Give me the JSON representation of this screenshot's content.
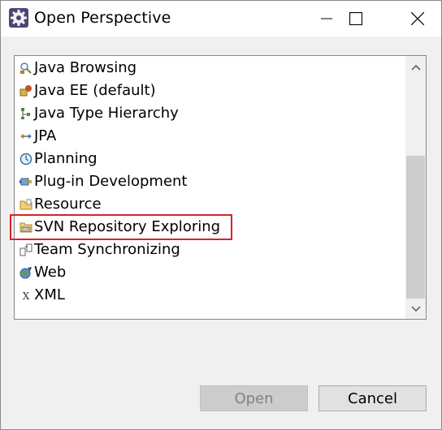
{
  "window": {
    "title": "Open Perspective",
    "controls": {
      "minimize": "minimize",
      "maximize": "maximize",
      "close": "close"
    }
  },
  "perspectives": [
    {
      "label": "Java Browsing",
      "icon": "java-browsing-icon"
    },
    {
      "label": "Java EE (default)",
      "icon": "java-ee-icon"
    },
    {
      "label": "Java Type Hierarchy",
      "icon": "type-hierarchy-icon"
    },
    {
      "label": "JPA",
      "icon": "jpa-icon"
    },
    {
      "label": "Planning",
      "icon": "planning-icon"
    },
    {
      "label": "Plug-in Development",
      "icon": "plugin-icon"
    },
    {
      "label": "Resource",
      "icon": "resource-icon"
    },
    {
      "label": "SVN Repository Exploring",
      "icon": "svn-icon",
      "highlighted": true
    },
    {
      "label": "Team Synchronizing",
      "icon": "team-sync-icon"
    },
    {
      "label": "Web",
      "icon": "web-icon"
    },
    {
      "label": "XML",
      "icon": "xml-icon"
    }
  ],
  "buttons": {
    "open": "Open",
    "cancel": "Cancel",
    "open_enabled": false
  },
  "colors": {
    "highlight_border": "#d9232b",
    "disabled_button": "#cccccc",
    "button": "#e1e1e1"
  }
}
